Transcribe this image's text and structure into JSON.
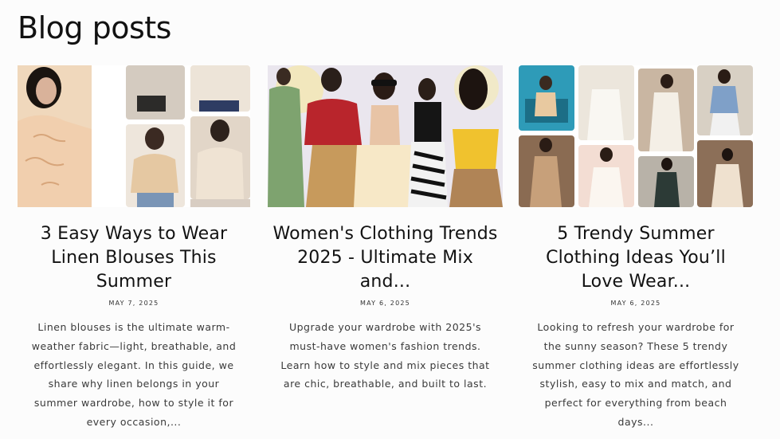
{
  "page": {
    "title": "Blog posts"
  },
  "posts": [
    {
      "title": "3 Easy Ways to Wear Linen Blouses This Summer",
      "date": "MAY 7, 2025",
      "excerpt": "Linen blouses is the ultimate warm-weather fabric—light, breathable, and effortlessly elegant. In this guide, we share why linen belongs in your summer wardrobe, how to style it for every occasion,..."
    },
    {
      "title": "Women's Clothing Trends 2025 - Ultimate Mix and...",
      "date": "MAY 6, 2025",
      "excerpt": "Upgrade your wardrobe with 2025's must-have women's fashion trends. Learn how to style and mix pieces that are chic, breathable, and built to last."
    },
    {
      "title": "5 Trendy Summer Clothing Ideas You’ll Love Wear...",
      "date": "MAY 6, 2025",
      "excerpt": "Looking to refresh your wardrobe for the sunny season? These 5 trendy summer clothing ideas are effortlessly stylish, easy to mix and match, and perfect for everything from beach days..."
    }
  ]
}
